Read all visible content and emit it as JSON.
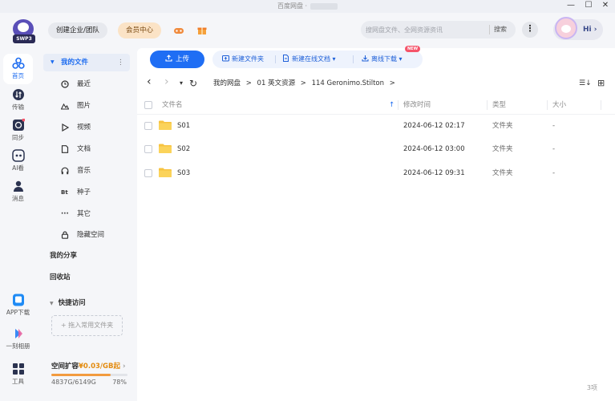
{
  "window": {
    "title": "百度网盘 ·",
    "minimize": "—",
    "maximize": "☐",
    "close": "✕"
  },
  "header": {
    "logo_badge": "SWP3",
    "corp_btn": "创建企业/团队",
    "vip_btn": "会员中心",
    "search_placeholder": "搜网盘文件、全网资源资讯",
    "search_btn": "搜索",
    "more": "⋮",
    "greeting": "Hi",
    "greeting_arrow": "›"
  },
  "rail": [
    {
      "label": "首页",
      "icon": "home-icon",
      "active": true
    },
    {
      "label": "传输",
      "icon": "transfer-icon",
      "active": false
    },
    {
      "label": "同步",
      "icon": "sync-icon",
      "active": false
    },
    {
      "label": "AI看",
      "icon": "ai-view-icon",
      "active": false
    },
    {
      "label": "消息",
      "icon": "message-icon",
      "active": false
    },
    {
      "label": "APP下载",
      "icon": "app-download-icon",
      "active": false
    },
    {
      "label": "一刻相册",
      "icon": "album-icon",
      "active": false
    },
    {
      "label": "工具",
      "icon": "tools-icon",
      "active": false
    }
  ],
  "sidebar": {
    "my_files": "我的文件",
    "my_files_more": "⋮",
    "items": [
      {
        "label": "最近",
        "icon": "clock-icon"
      },
      {
        "label": "图片",
        "icon": "image-icon"
      },
      {
        "label": "视频",
        "icon": "video-icon"
      },
      {
        "label": "文档",
        "icon": "document-icon"
      },
      {
        "label": "音乐",
        "icon": "headphones-icon"
      },
      {
        "label": "种子",
        "icon": "torrent-icon"
      },
      {
        "label": "其它",
        "icon": "other-icon"
      },
      {
        "label": "隐藏空间",
        "icon": "lock-icon"
      }
    ],
    "torrent_glyph": "Bt",
    "other_glyph": "···",
    "my_share": "我的分享",
    "recycle": "回收站",
    "quick_access": "快捷访问",
    "add_fav": "+ 拖入常用文件夹",
    "quota_label": "空间扩容",
    "quota_price": "¥0.03/GB起",
    "quota_arrow": "›",
    "quota_used": "4837G/6149G",
    "quota_pct": "78%",
    "quota_fraction": 0.78
  },
  "toolbar": {
    "upload": "上传",
    "new_folder": "新建文件夹",
    "new_online_doc": "新建在线文档",
    "new_badge": "NEW",
    "offline_download": "离线下载",
    "dropdown_caret": "▾"
  },
  "nav": {
    "back": "‹",
    "forward": "›",
    "dropdown": "▾",
    "refresh": "↻",
    "crumbs": [
      "我的网盘",
      "01 英文资源",
      "114 Geronimo.Stilton"
    ],
    "sep": ">",
    "sort_icon": "☰↓",
    "grid_icon": "⊞"
  },
  "table": {
    "columns": {
      "name": "文件名",
      "sort_arrow": "↑",
      "modified": "修改时间",
      "type": "类型",
      "size": "大小"
    },
    "rows": [
      {
        "name": "S01",
        "modified": "2024-06-12 02:17",
        "type": "文件夹",
        "size": "-"
      },
      {
        "name": "S02",
        "modified": "2024-06-12 03:00",
        "type": "文件夹",
        "size": "-"
      },
      {
        "name": "S03",
        "modified": "2024-06-12 09:31",
        "type": "文件夹",
        "size": "-"
      }
    ],
    "count": "3项"
  },
  "colors": {
    "accent": "#1f6ef4",
    "folder": "#f7c340",
    "vip": "#fbe3c6",
    "quota_bar": "#f29b3f"
  }
}
